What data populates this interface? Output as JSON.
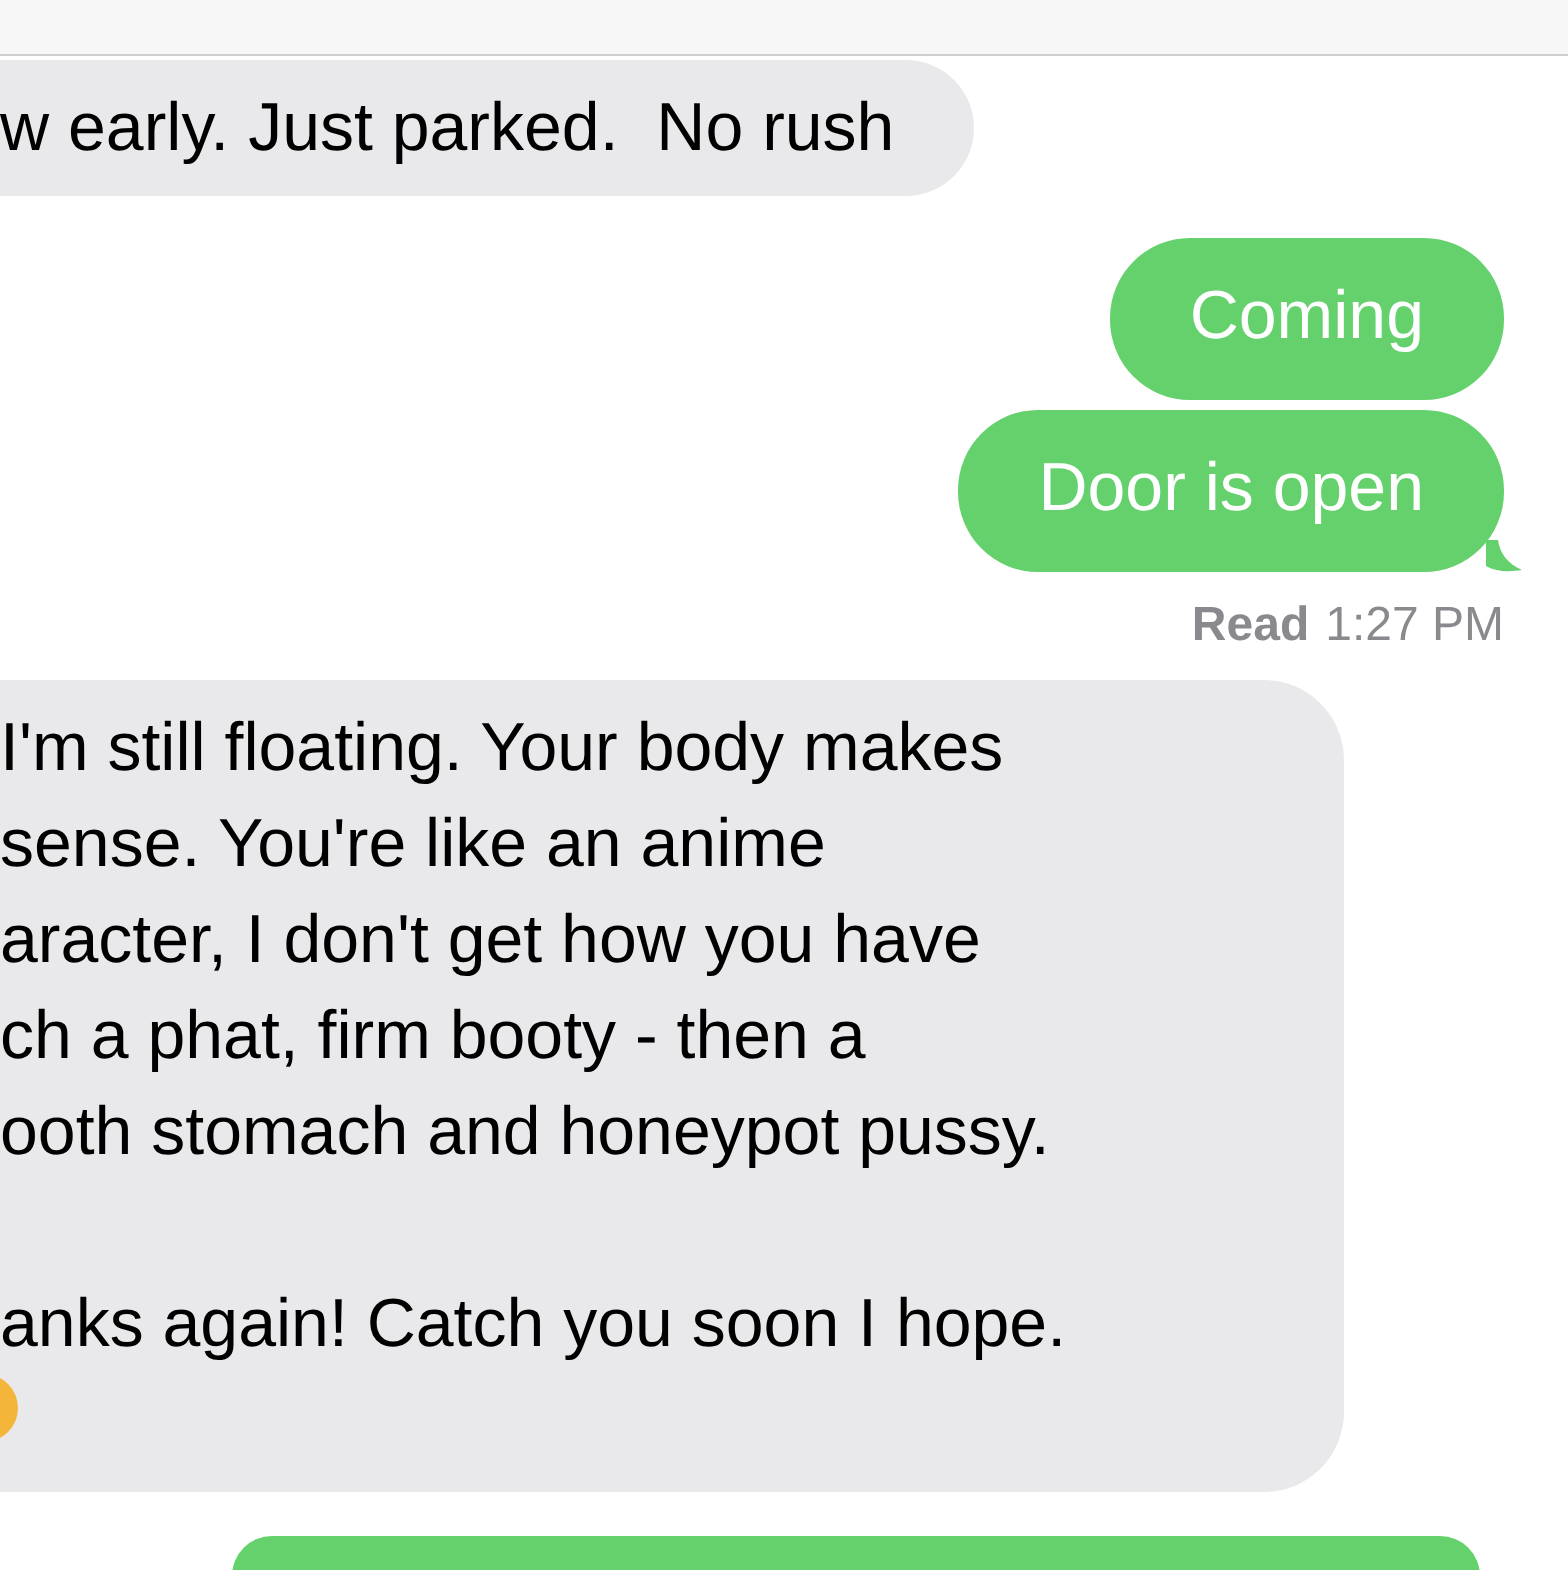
{
  "messages": [
    {
      "kind": "received",
      "paragraphs": [
        "w early. Just parked.  No rush"
      ]
    },
    {
      "kind": "sent",
      "paragraphs": [
        "Coming"
      ],
      "tail": false
    },
    {
      "kind": "sent",
      "paragraphs": [
        "Door is open"
      ],
      "tail": true
    },
    {
      "kind": "receipt",
      "label": "Read",
      "time": "1:27 PM"
    },
    {
      "kind": "received",
      "paragraphs": [
        "I'm still floating. Your body makes\nsense. You're like an anime\naracter, I don't get how you have\nch a phat, firm booty - then a\nooth stomach and honeypot pussy.",
        "anks again! Catch you soon I hope."
      ],
      "trailing_emoji": true
    },
    {
      "kind": "sent"
    }
  ]
}
